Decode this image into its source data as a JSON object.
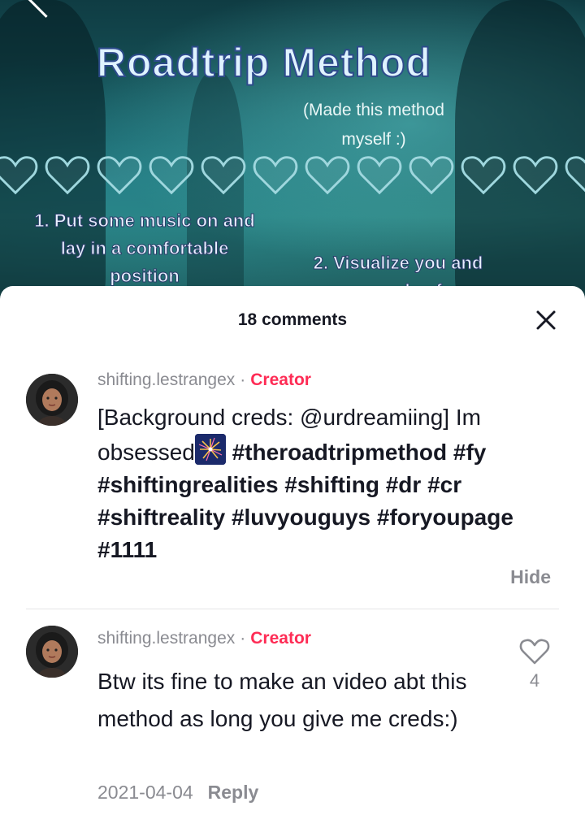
{
  "video": {
    "title": "Roadtrip Method",
    "subtitle_line1": "(Made this method",
    "subtitle_line2": "myself :)",
    "step1_line1": "1. Put some music on and",
    "step1_line2": "lay in a comfortable",
    "step1_line3": "position",
    "step2_line1": "2. Visualize you and",
    "step2_line2": "some people of your DR"
  },
  "comments_panel": {
    "title": "18 comments",
    "comments": [
      {
        "username": "shifting.lestrangex",
        "badge": "Creator",
        "separator": "·",
        "text_plain": "[Background creds: @urdreamiing] Im obsessed",
        "hashtags": "#theroadtripmethod #fy #shiftingrealities #shifting #dr #cr #shiftreality #luvyouguys #foryoupage #1111",
        "hide_label": "Hide"
      },
      {
        "username": "shifting.lestrangex",
        "badge": "Creator",
        "separator": "·",
        "text": "Btw its fine to make an video abt this method as long you give me creds:)",
        "likes": "4",
        "date": "2021-04-04",
        "reply_label": "Reply"
      }
    ]
  },
  "colors": {
    "creator_badge": "#fe2c55",
    "muted_text": "#8a8b91",
    "primary_text": "#161823"
  },
  "icons": {
    "close": "close-icon",
    "like": "heart-outline-icon",
    "emoji": "fireworks-emoji-icon"
  }
}
